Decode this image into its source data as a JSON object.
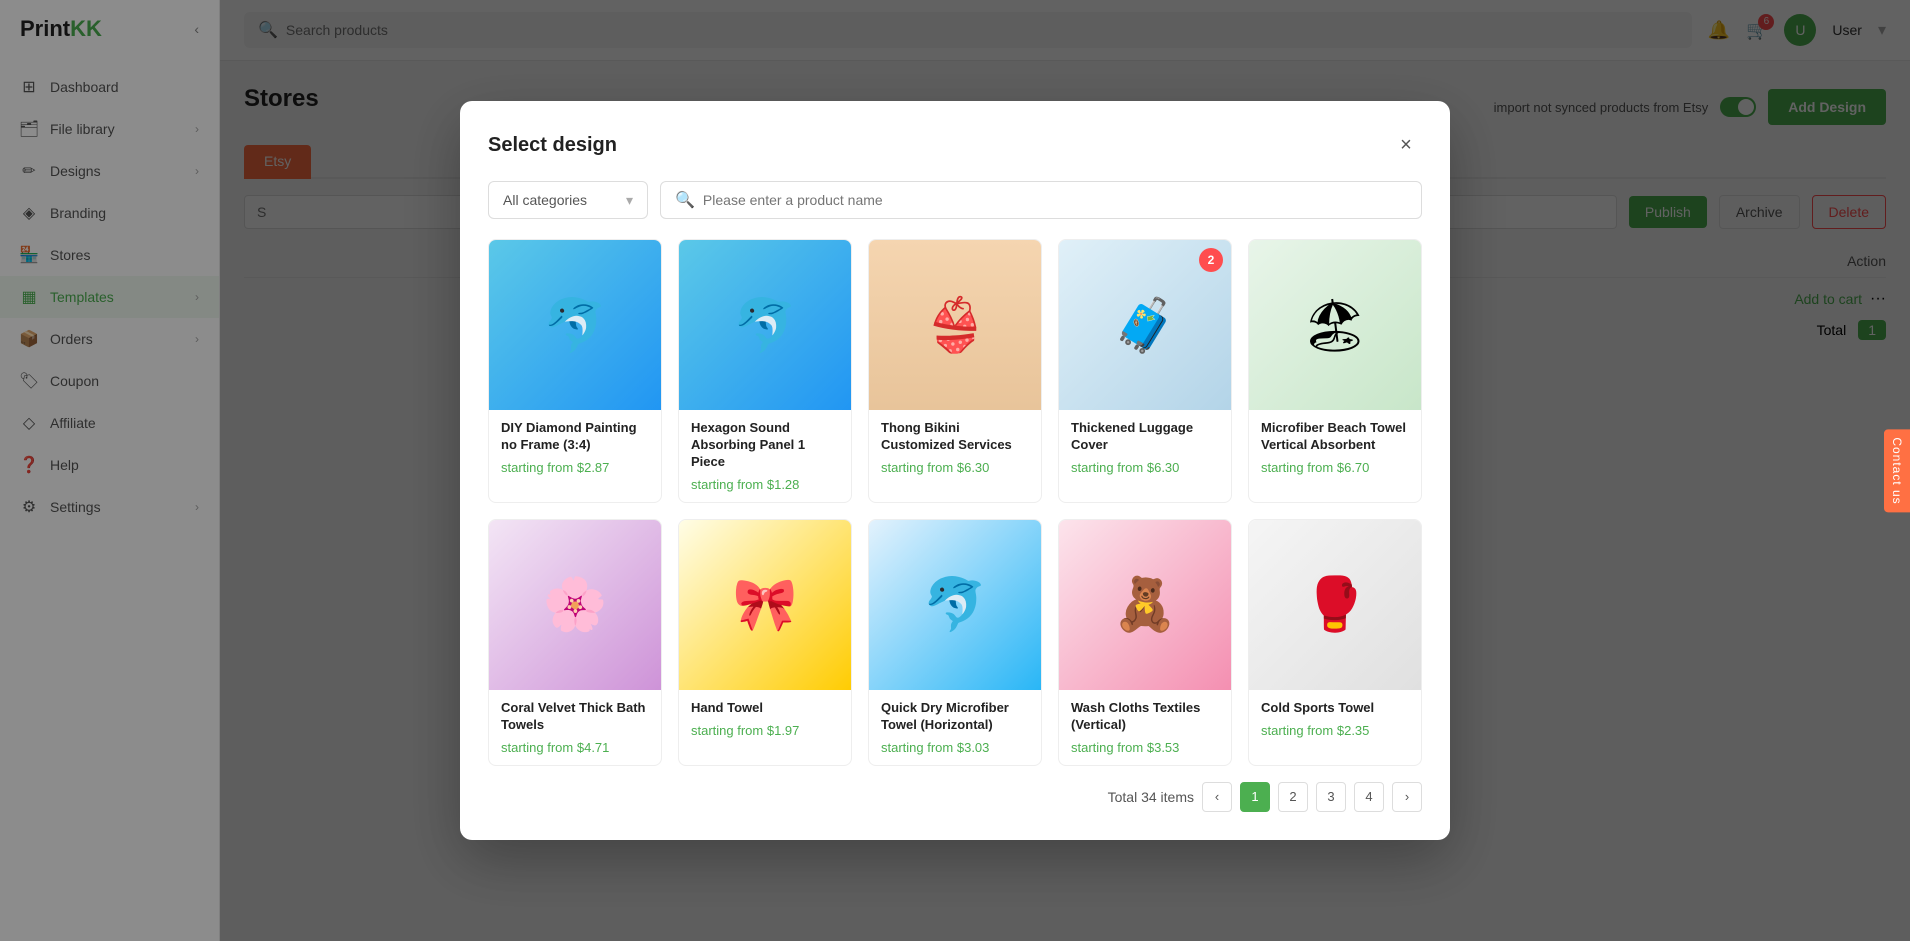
{
  "app": {
    "logo": "PrintKK",
    "logo_accent": "KK"
  },
  "sidebar": {
    "items": [
      {
        "id": "dashboard",
        "label": "Dashboard",
        "icon": "⊞",
        "arrow": false
      },
      {
        "id": "file-library",
        "label": "File library",
        "icon": "📁",
        "arrow": true
      },
      {
        "id": "designs",
        "label": "Designs",
        "icon": "🎨",
        "arrow": true
      },
      {
        "id": "branding",
        "label": "Branding",
        "icon": "◈",
        "arrow": false
      },
      {
        "id": "stores",
        "label": "Stores",
        "icon": "🏪",
        "arrow": false
      },
      {
        "id": "templates",
        "label": "Templates",
        "icon": "⊡",
        "arrow": true
      },
      {
        "id": "orders",
        "label": "Orders",
        "icon": "📦",
        "arrow": true
      },
      {
        "id": "coupon",
        "label": "Coupon",
        "icon": "🏷",
        "arrow": false
      },
      {
        "id": "affiliate",
        "label": "Affiliate",
        "icon": "◇",
        "arrow": false
      },
      {
        "id": "help",
        "label": "Help",
        "icon": "❓",
        "arrow": false
      },
      {
        "id": "settings",
        "label": "Settings",
        "icon": "⚙",
        "arrow": true
      }
    ]
  },
  "header": {
    "search_placeholder": "Search products",
    "notification_count": "",
    "cart_count": "6",
    "user_initials": "U"
  },
  "page": {
    "title": "Stores",
    "synced_label": "import not synced products from Etsy",
    "add_design_label": "Add Design",
    "tabs": [
      {
        "label": "Etsy",
        "active": true
      }
    ],
    "toolbar": {
      "search_placeholder": "S",
      "publish_label": "Publish",
      "archive_label": "Archive",
      "delete_label": "Delete"
    },
    "table": {
      "action_header": "Action",
      "add_to_cart": "Add to cart",
      "total_label": "Total",
      "total_qty": "1"
    }
  },
  "modal": {
    "title": "Select design",
    "close_label": "×",
    "filter": {
      "category_placeholder": "All categories",
      "search_placeholder": "Please enter a product name"
    },
    "products": [
      {
        "id": 1,
        "name": "DIY Diamond Painting no Frame (3:4)",
        "price": "starting from $2.87",
        "badge": null,
        "thumb_type": "thumb-dolphin-card",
        "emoji": "🐬"
      },
      {
        "id": 2,
        "name": "Hexagon Sound Absorbing Panel 1 Piece",
        "price": "starting from $1.28",
        "badge": null,
        "thumb_type": "thumb-dolphin-card",
        "emoji": "🐬"
      },
      {
        "id": 3,
        "name": "Thong Bikini Customized Services",
        "price": "starting from $6.30",
        "badge": null,
        "thumb_type": "thumb-bikini",
        "emoji": "👙"
      },
      {
        "id": 4,
        "name": "Thickened Luggage Cover",
        "price": "starting from $6.30",
        "badge": "2",
        "thumb_type": "thumb-luggage",
        "emoji": "🧳"
      },
      {
        "id": 5,
        "name": "Microfiber Beach Towel Vertical Absorbent",
        "price": "starting from $6.70",
        "badge": null,
        "thumb_type": "thumb-beach-towel",
        "emoji": "🏖"
      },
      {
        "id": 6,
        "name": "Coral Velvet Thick Bath Towels",
        "price": "starting from $4.71",
        "badge": null,
        "thumb_type": "thumb-bath-towel",
        "emoji": "🌸"
      },
      {
        "id": 7,
        "name": "Hand Towel",
        "price": "starting from $1.97",
        "badge": null,
        "thumb_type": "thumb-hand-towel",
        "emoji": "🎀"
      },
      {
        "id": 8,
        "name": "Quick Dry Microfiber Towel (Horizontal)",
        "price": "starting from $3.03",
        "badge": null,
        "thumb_type": "thumb-microfiber",
        "emoji": "🐬"
      },
      {
        "id": 9,
        "name": "Wash Cloths Textiles (Vertical)",
        "price": "starting from $3.53",
        "badge": null,
        "thumb_type": "thumb-wash-cloth",
        "emoji": "🧸"
      },
      {
        "id": 10,
        "name": "Cold Sports Towel",
        "price": "starting from $2.35",
        "badge": null,
        "thumb_type": "thumb-cold-sports",
        "emoji": "🥊"
      }
    ],
    "pagination": {
      "total_items": "Total 34 items",
      "current_page": 1,
      "pages": [
        1,
        2,
        3,
        4
      ]
    }
  },
  "contact": {
    "label": "Contact us"
  }
}
